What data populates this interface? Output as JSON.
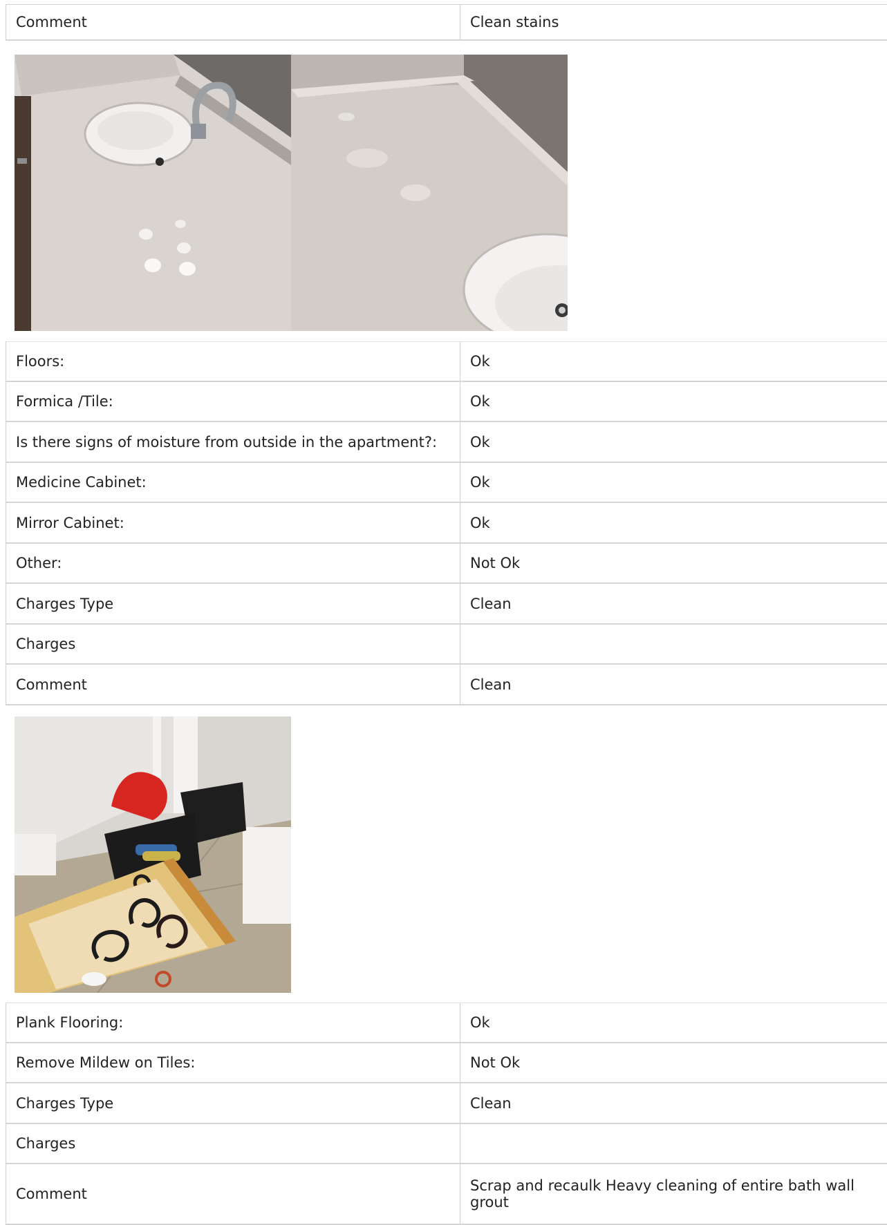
{
  "sections": [
    {
      "rows": [
        {
          "label": "Comment",
          "value": "Clean stains"
        }
      ]
    },
    {
      "rows": [
        {
          "label": "Floors:",
          "value": "Ok"
        },
        {
          "label": "Formica /Tile:",
          "value": "Ok"
        },
        {
          "label": "Is there signs of moisture from outside in the apartment?:",
          "value": "Ok"
        },
        {
          "label": "Medicine Cabinet:",
          "value": "Ok"
        },
        {
          "label": "Mirror Cabinet:",
          "value": "Ok"
        },
        {
          "label": "Other:",
          "value": "Not Ok"
        },
        {
          "label": "Charges Type",
          "value": "Clean"
        },
        {
          "label": "Charges",
          "value": ""
        },
        {
          "label": "Comment",
          "value": "Clean"
        }
      ]
    },
    {
      "rows": [
        {
          "label": "Plank Flooring:",
          "value": "Ok"
        },
        {
          "label": "Remove Mildew on Tiles:",
          "value": "Not Ok"
        },
        {
          "label": "Charges Type",
          "value": "Clean"
        },
        {
          "label": "Charges",
          "value": ""
        },
        {
          "label": "Comment",
          "value": "Scrap and recaulk Heavy cleaning of entire bath wall grout"
        }
      ]
    }
  ],
  "photos": {
    "vanity_sink": {
      "icon": "sink-countertop-photo"
    },
    "vanity_counter": {
      "icon": "countertop-stains-photo"
    },
    "drawer": {
      "icon": "open-drawer-photo"
    }
  }
}
